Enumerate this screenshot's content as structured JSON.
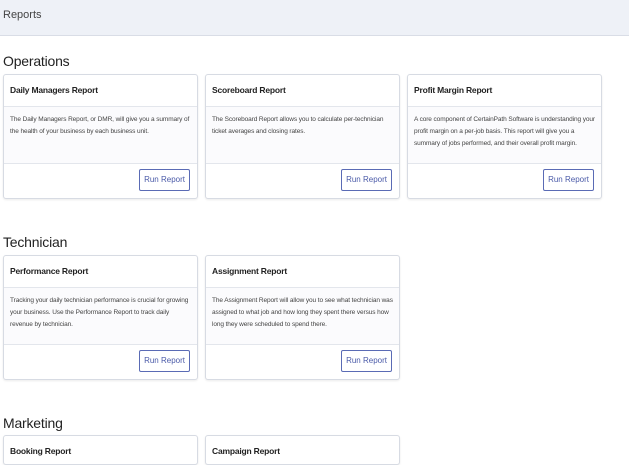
{
  "breadcrumb": "Reports",
  "sections": {
    "operations": {
      "title": "Operations",
      "cards": [
        {
          "title": "Daily Managers Report",
          "desc": "The Daily Managers Report, or DMR, will give you a summary of the health of your business by each business unit.",
          "button": "Run Report"
        },
        {
          "title": "Scoreboard Report",
          "desc": "The Scoreboard Report allows you to calculate per-technician ticket averages and closing rates.",
          "button": "Run Report"
        },
        {
          "title": "Profit Margin Report",
          "desc": "A core component of CertainPath Software is understanding your profit margin on a per-job basis. This report will give you a summary of jobs performed, and their overall profit margin.",
          "button": "Run Report"
        }
      ]
    },
    "technician": {
      "title": "Technician",
      "cards": [
        {
          "title": "Performance Report",
          "desc": "Tracking your daily technician performance is crucial for growing your business. Use the Performance Report to track daily revenue by technician.",
          "button": "Run Report"
        },
        {
          "title": "Assignment Report",
          "desc": "The Assignment Report will allow you to see what technician was assigned to what job and how long they spent there versus how long they were scheduled to spend there.",
          "button": "Run Report"
        }
      ]
    },
    "marketing": {
      "title": "Marketing",
      "cards": [
        {
          "title": "Booking Report"
        },
        {
          "title": "Campaign Report"
        }
      ]
    }
  }
}
